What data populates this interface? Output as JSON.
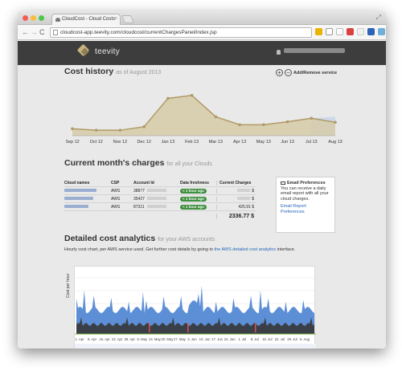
{
  "browser": {
    "tab_title": "CloudCost - Cloud Costs",
    "tab_close": "×",
    "url": "cloudcost-app.teevity.com/cloudcost/currentChargesPanel/index.jsp",
    "nav_back": "←",
    "nav_forward": "→",
    "nav_reload": "C",
    "resize": "⤢"
  },
  "app": {
    "brand": "teevity"
  },
  "cost_history": {
    "title": "Cost history",
    "subtitle": "as of August 2013",
    "add_remove_label": "Add/Remove service",
    "add_symbol": "+",
    "remove_symbol": "−"
  },
  "chart_data": [
    {
      "type": "area",
      "categories": [
        "Sep 12",
        "Oct 12",
        "Nov 12",
        "Dec 12",
        "Jan 13",
        "Feb 13",
        "Mar 13",
        "Apr 13",
        "May 13",
        "Jun 13",
        "Jul 13",
        "Aug 13"
      ],
      "values": [
        14,
        11,
        11,
        18,
        75,
        81,
        38,
        22,
        22,
        28,
        35,
        27
      ],
      "series_colors": {
        "line": "#b09a67",
        "fill": "#d6cba8",
        "forecast": "#c6d4ea"
      },
      "ylim": [
        0,
        100
      ],
      "grid": false
    },
    {
      "type": "area",
      "x_ticks": [
        "1. Apr",
        "8. Apr",
        "15. Apr",
        "22. Apr",
        "29. Apr",
        "6. May",
        "13. May",
        "20. May",
        "27. May",
        "3. Jun",
        "10. Jun",
        "17. Jun",
        "24. Jun",
        "1. Jul",
        "8. Jul",
        "15. Jul",
        "22. Jul",
        "29. Jul",
        "5. Aug"
      ],
      "ylabel": "Cost per hour",
      "series_colors": [
        "#5d8fd6",
        "#3a3f47",
        "#8bc34a",
        "#d9534f"
      ],
      "grid": true
    }
  ],
  "current_charges": {
    "title": "Current month's charges",
    "subtitle": "for all your Clouds",
    "headers": [
      "Cloud names",
      "CSP",
      "Account Id",
      "Data freshness",
      "Current Charges"
    ],
    "rows": [
      {
        "csp": "AWS",
        "account": "38877",
        "freshness": "< 1 hour ago",
        "charge": "$"
      },
      {
        "csp": "AWS",
        "account": "35427",
        "freshness": "< 1 hour ago",
        "charge": "$"
      },
      {
        "csp": "AWS",
        "account": "87311",
        "freshness": "< 1 hour ago",
        "charge": "425.91 $"
      }
    ],
    "total": "2336.77 $"
  },
  "email_prefs": {
    "title": "Email Preferences",
    "body": "You can receive a daily email report with all your cloud charges.",
    "link": "Email Report Preferences"
  },
  "detailed": {
    "title": "Detailed cost analytics",
    "subtitle": "for your AWS accounts",
    "desc_prefix": "Hourly cost chart, per AWS service used. Get further cost details by going to ",
    "desc_link": "the AWS detailed cost analytics",
    "desc_suffix": " interface."
  }
}
